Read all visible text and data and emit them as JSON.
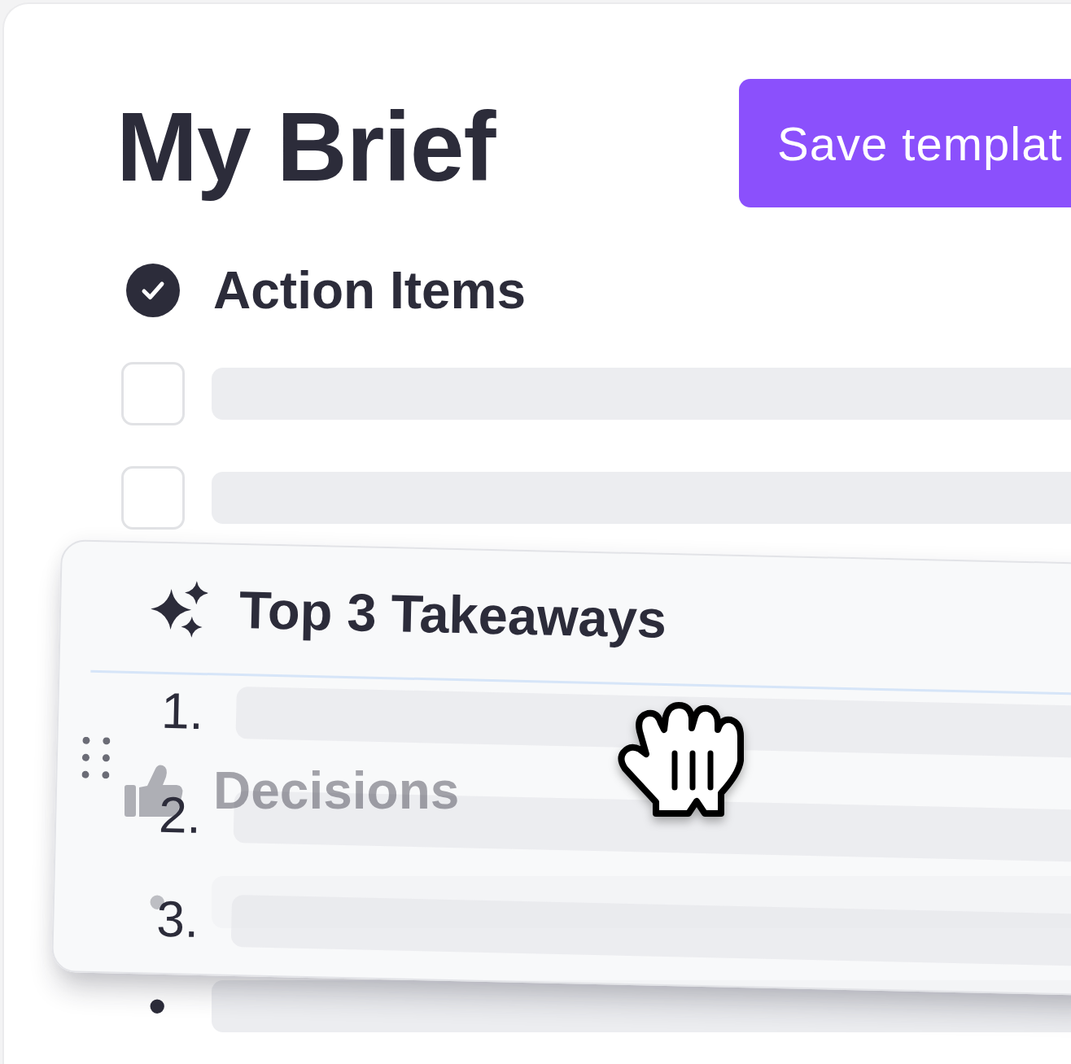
{
  "header": {
    "title": "My Brief",
    "save_button": "Save templat"
  },
  "sections": [
    {
      "kind": "checklist",
      "heading": "Action Items",
      "items": [
        {
          "checked": false
        },
        {
          "checked": false
        }
      ]
    },
    {
      "kind": "bulleted",
      "heading": "Decisions",
      "items": [
        {
          "marker": "•"
        },
        {
          "marker": "•"
        }
      ]
    }
  ],
  "dragged_section": {
    "kind": "numbered",
    "heading": "Top 3 Takeaways",
    "dragging": true,
    "items": [
      {
        "marker": "1."
      },
      {
        "marker": "2."
      },
      {
        "marker": "3."
      }
    ]
  }
}
